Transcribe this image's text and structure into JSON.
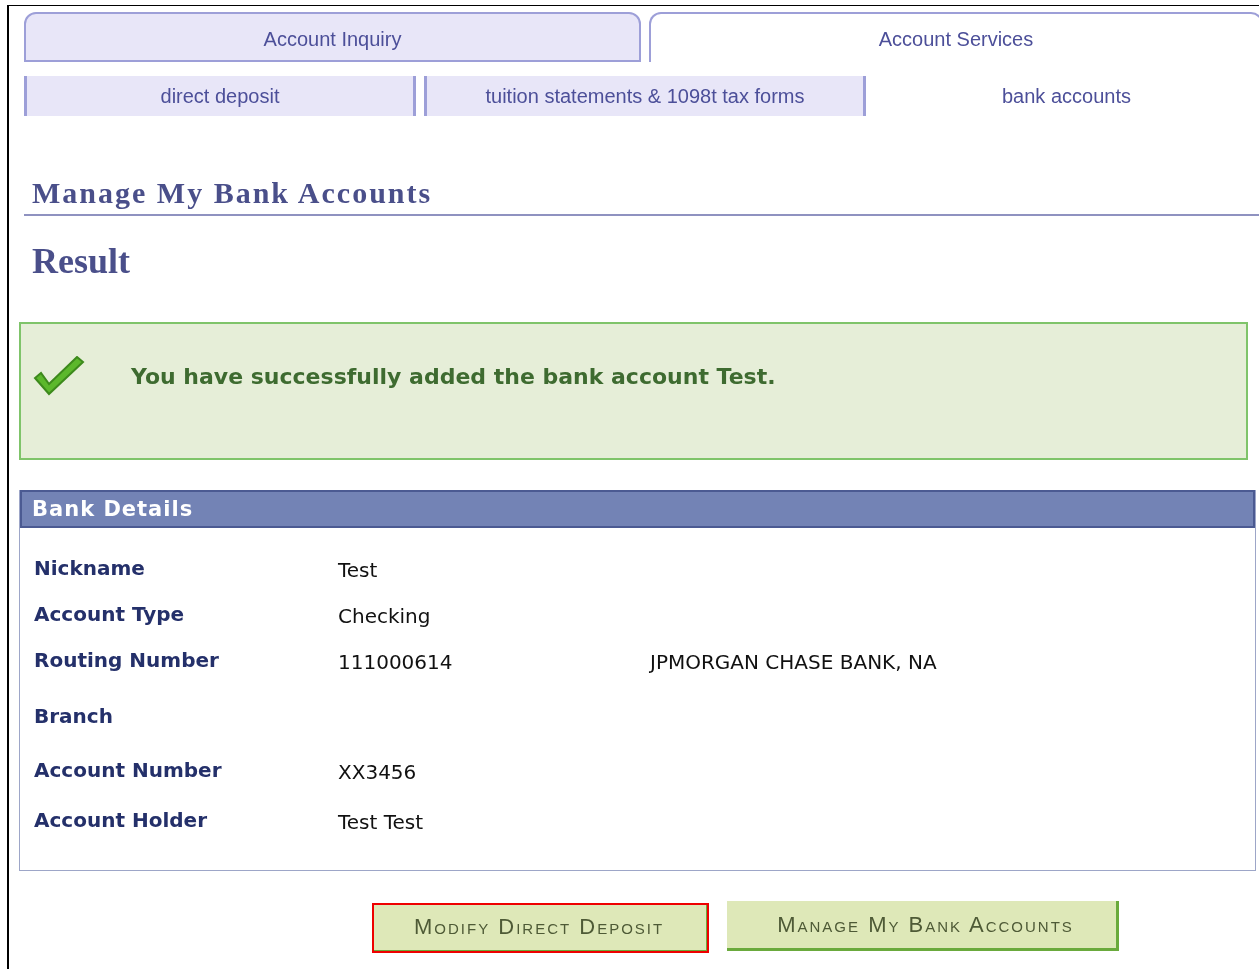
{
  "tabs": [
    {
      "label": "Account Inquiry",
      "selected": false
    },
    {
      "label": "Account Services",
      "selected": true
    }
  ],
  "subtabs": [
    {
      "label": "direct deposit",
      "selected": false
    },
    {
      "label": "tuition statements & 1098t tax forms",
      "selected": false
    },
    {
      "label": "bank accounts",
      "selected": true
    }
  ],
  "page_title": "Manage My Bank Accounts",
  "section_title": "Result",
  "message": {
    "kind": "success",
    "text": "You have successfully added the bank account Test."
  },
  "bank_details": {
    "title": "Bank Details",
    "rows": [
      {
        "label": "Nickname",
        "value": "Test"
      },
      {
        "label": "Account Type",
        "value": "Checking"
      },
      {
        "label": "Routing Number",
        "value": "111000614",
        "extra": "JPMORGAN CHASE BANK, NA"
      },
      {
        "label": "Branch"
      },
      {
        "label": "Account Number",
        "value": "XX3456"
      },
      {
        "label": "Account Holder",
        "value": "Test Test"
      }
    ]
  },
  "buttons": [
    {
      "label": "Modify Direct Deposit",
      "focused": true
    },
    {
      "label": "Manage My Bank Accounts",
      "focused": false
    }
  ]
}
